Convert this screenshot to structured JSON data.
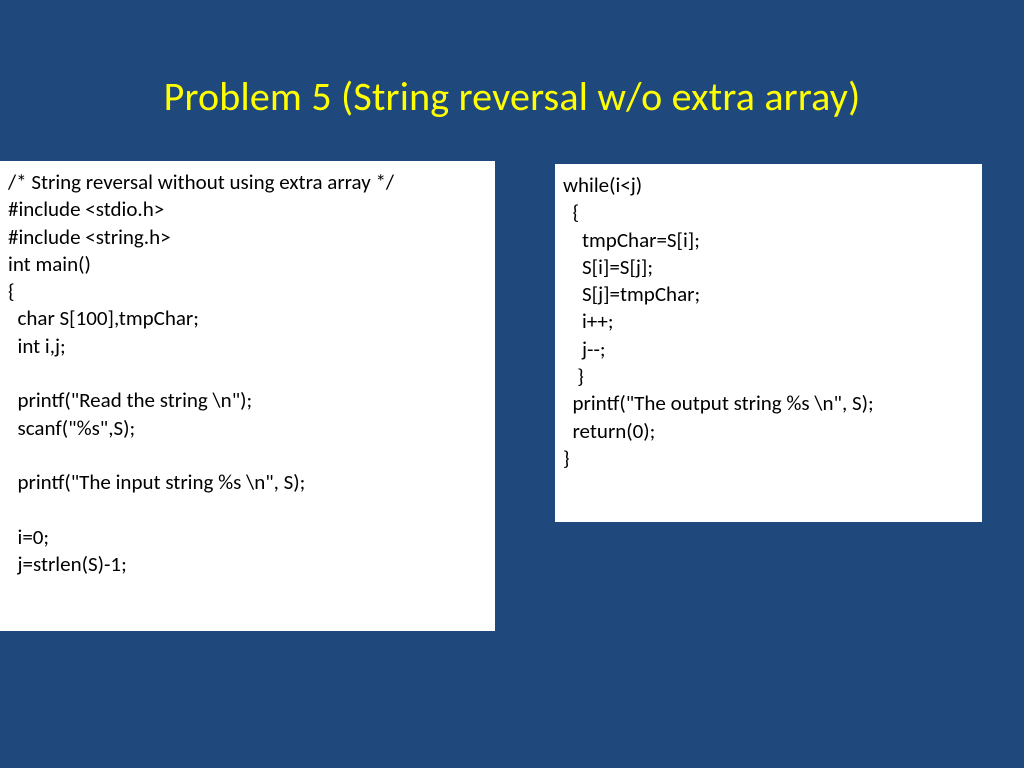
{
  "slide": {
    "title": "Problem 5 (String reversal w/o extra array)",
    "code_left": "/* String reversal without using extra array */\n#include <stdio.h>\n#include <string.h>\nint main()\n{\n  char S[100],tmpChar;\n  int i,j;\n\n  printf(\"Read the string \\n\");\n  scanf(\"%s\",S);\n\n  printf(\"The input string %s \\n\", S);\n\n  i=0;\n  j=strlen(S)-1;",
    "code_right": "while(i<j)\n  {\n    tmpChar=S[i];\n    S[i]=S[j];\n    S[j]=tmpChar;\n    i++;\n    j--;\n   }\n  printf(\"The output string %s \\n\", S);\n  return(0);\n}"
  }
}
